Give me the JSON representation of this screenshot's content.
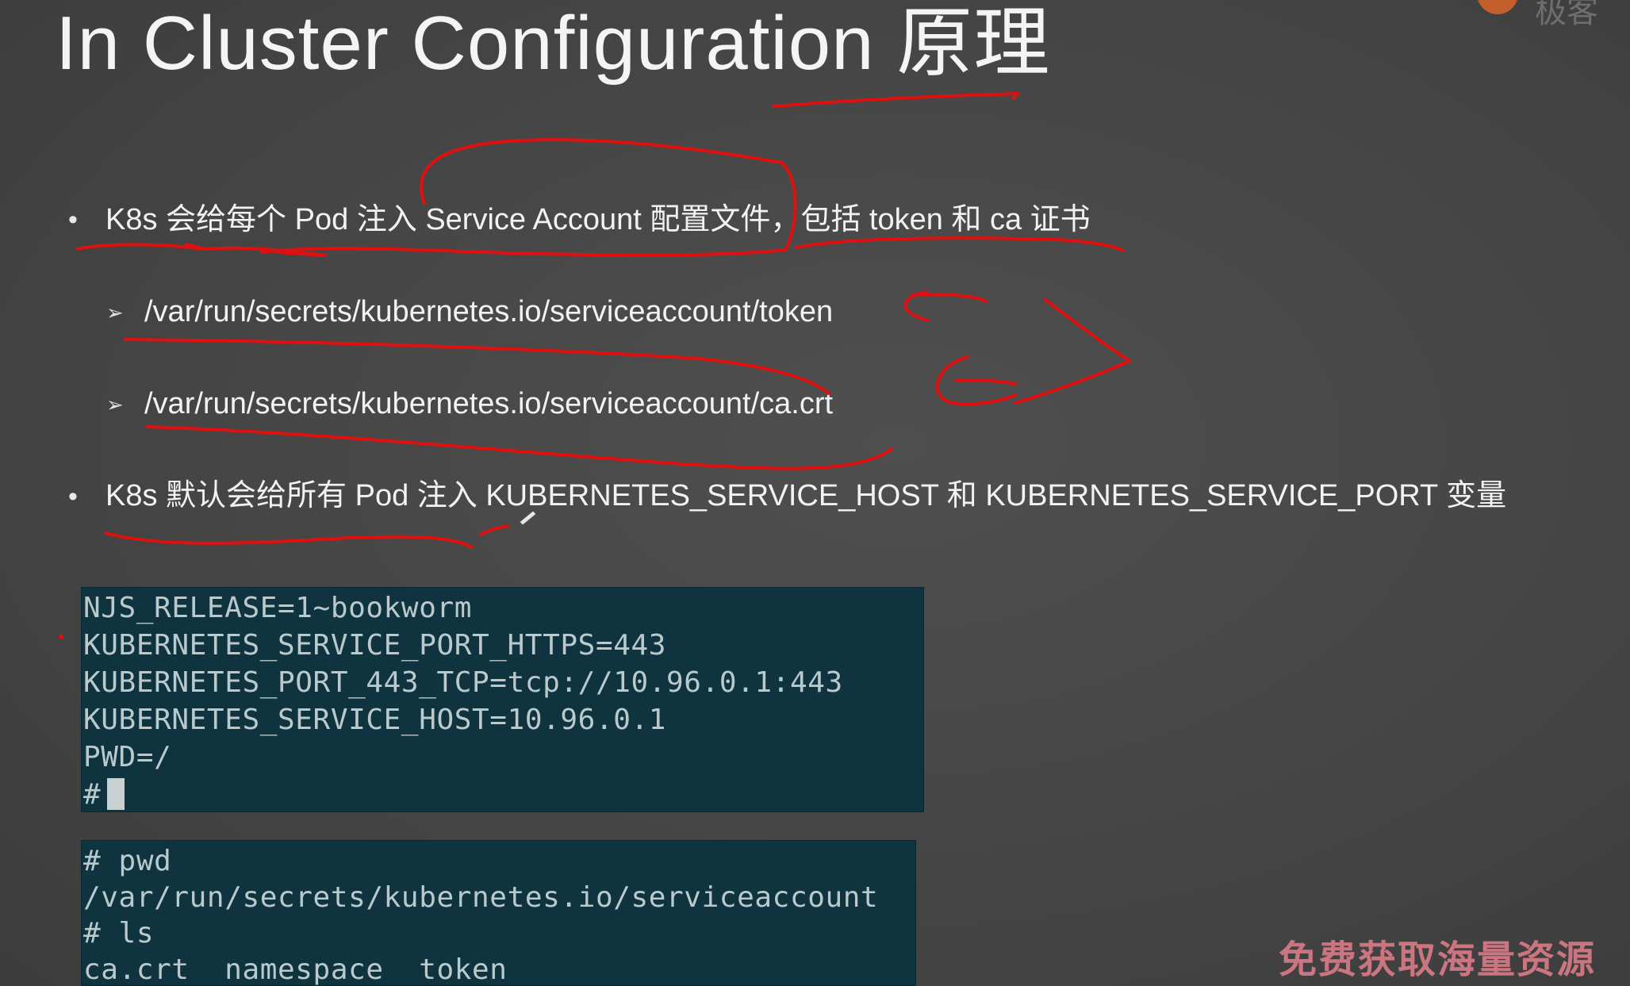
{
  "slide": {
    "title": "In Cluster Configuration 原理",
    "bullets": [
      {
        "text": "K8s 会给每个 Pod 注入 Service Account 配置文件，包括 token 和 ca 证书",
        "sub_items": [
          "/var/run/secrets/kubernetes.io/serviceaccount/token",
          "/var/run/secrets/kubernetes.io/serviceaccount/ca.crt"
        ]
      },
      {
        "text": "K8s 默认会给所有 Pod 注入 KUBERNETES_SERVICE_HOST 和 KUBERNETES_SERVICE_PORT 变量"
      }
    ],
    "bullet_glyph": "•",
    "sub_bullet_glyph": "➢"
  },
  "terminal_env": {
    "lines": [
      "NJS_RELEASE=1~bookworm",
      "KUBERNETES_SERVICE_PORT_HTTPS=443",
      "KUBERNETES_PORT_443_TCP=tcp://10.96.0.1:443",
      "KUBERNETES_SERVICE_HOST=10.96.0.1",
      "PWD=/"
    ],
    "prompt": "#"
  },
  "terminal_ls": {
    "lines": [
      "# pwd",
      "/var/run/secrets/kubernetes.io/serviceaccount",
      "# ls",
      "ca.crt  namespace  token"
    ]
  },
  "watermark": "免费获取海量资源",
  "colors": {
    "background": "#474747",
    "terminal_bg": "#0f3440",
    "terminal_text": "#b9c9cc",
    "annotation": "#e01010",
    "watermark": "#d77a86"
  }
}
